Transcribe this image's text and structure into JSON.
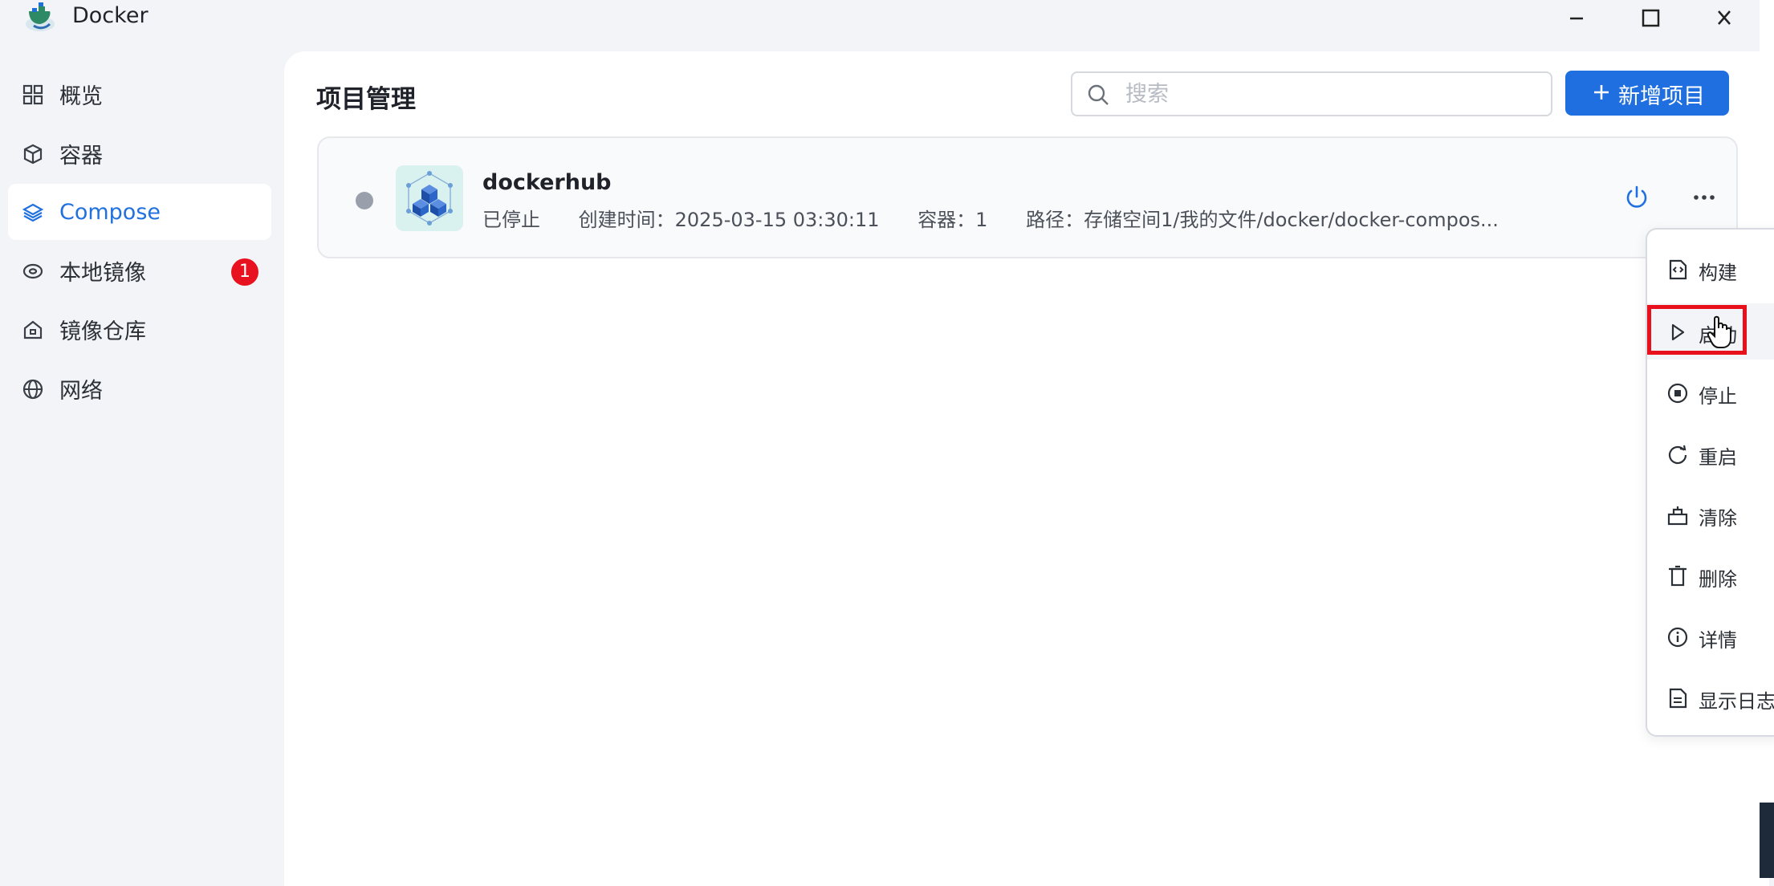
{
  "window": {
    "title": "Docker",
    "minimize_icon": "minimize-icon",
    "maximize_icon": "maximize-icon",
    "close_icon": "close-icon"
  },
  "sidebar": {
    "items": [
      {
        "label": "概览",
        "icon": "grid-icon",
        "active": false
      },
      {
        "label": "容器",
        "icon": "cube-icon",
        "active": false
      },
      {
        "label": "Compose",
        "icon": "layers-icon",
        "active": true
      },
      {
        "label": "本地镜像",
        "icon": "disk-icon",
        "active": false,
        "badge": "1"
      },
      {
        "label": "镜像仓库",
        "icon": "home-icon",
        "active": false
      },
      {
        "label": "网络",
        "icon": "globe-icon",
        "active": false
      }
    ]
  },
  "main": {
    "title": "项目管理",
    "search": {
      "placeholder": "搜索",
      "value": ""
    },
    "add_button": "新增项目"
  },
  "project": {
    "name": "dockerhub",
    "status": "已停止",
    "created": "创建时间：2025-03-15 03:30:11",
    "containers": "容器：1",
    "path": "路径：存储空间1/我的文件/docker/docker-compos..."
  },
  "context_menu": {
    "items": [
      {
        "label": "构建",
        "icon": "build-icon"
      },
      {
        "label": "启动",
        "icon": "play-icon"
      },
      {
        "label": "停止",
        "icon": "stop-icon"
      },
      {
        "label": "重启",
        "icon": "restart-icon"
      },
      {
        "label": "清除",
        "icon": "clear-icon"
      },
      {
        "label": "删除",
        "icon": "trash-icon"
      },
      {
        "label": "详情",
        "icon": "info-icon"
      },
      {
        "label": "显示日志",
        "icon": "log-icon"
      }
    ]
  },
  "colors": {
    "accent": "#1f6fe0",
    "badge": "#e8111f",
    "highlight": "#e8101a"
  }
}
